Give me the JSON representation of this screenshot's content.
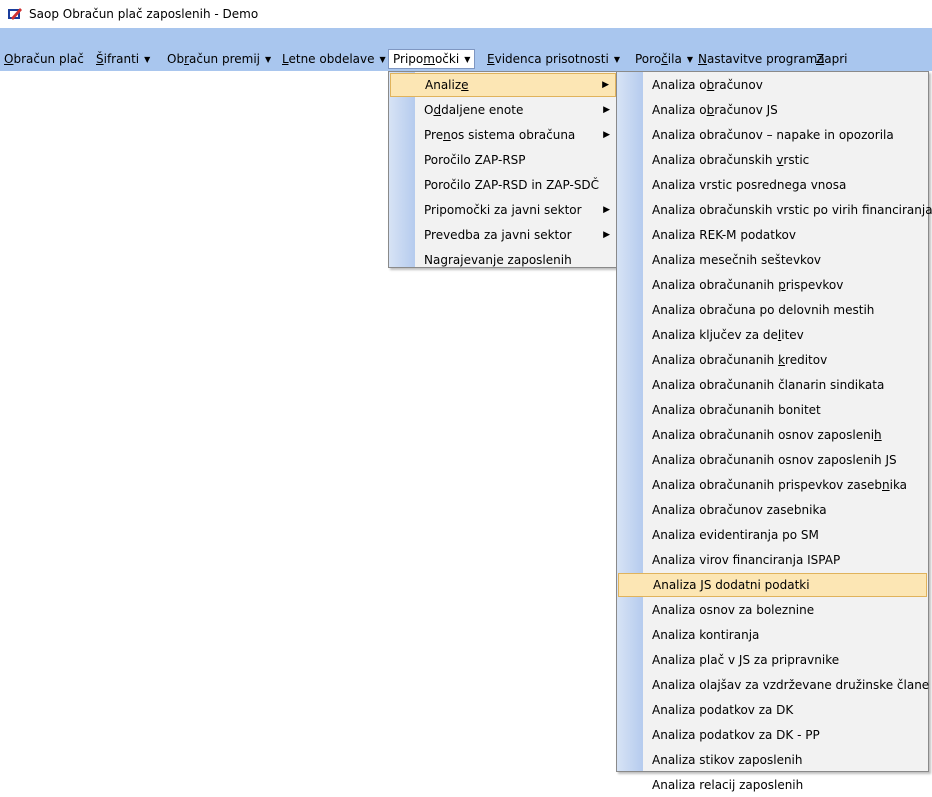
{
  "window": {
    "title": "Saop Obračun plač zaposlenih  - Demo",
    "icon": "app-icon"
  },
  "menubar": {
    "items": [
      {
        "pre": "",
        "key": "O",
        "post": "bračun plač",
        "arrow": false
      },
      {
        "pre": "",
        "key": "Š",
        "post": "ifranti",
        "arrow": true
      },
      {
        "pre": "Ob",
        "key": "r",
        "post": "ačun premij",
        "arrow": true
      },
      {
        "pre": "",
        "key": "L",
        "post": "etne obdelave",
        "arrow": true
      },
      {
        "pre": "Pripo",
        "key": "m",
        "post": "očki",
        "arrow": true
      },
      {
        "pre": "",
        "key": "E",
        "post": "videnca prisotnosti",
        "arrow": true
      },
      {
        "pre": "Poro",
        "key": "č",
        "post": "ila",
        "arrow": true
      },
      {
        "pre": "",
        "key": "N",
        "post": "astavitve programa",
        "arrow": false
      },
      {
        "pre": "",
        "key": "Z",
        "post": "apri",
        "arrow": false
      }
    ]
  },
  "submenu": {
    "items": [
      {
        "pre": "Analiz",
        "key": "e",
        "post": "",
        "arrow": true
      },
      {
        "pre": "O",
        "key": "d",
        "post": "daljene enote",
        "arrow": true
      },
      {
        "pre": "Pre",
        "key": "n",
        "post": "os sistema obračuna",
        "arrow": true
      },
      {
        "pre": "Poročilo ZAP-RSP",
        "key": "",
        "post": "",
        "arrow": false
      },
      {
        "pre": "Poročilo ZAP-RSD  in ZAP-SDČ",
        "key": "",
        "post": "",
        "arrow": false
      },
      {
        "pre": "Pripomočki za javni sektor",
        "key": "",
        "post": "",
        "arrow": true
      },
      {
        "pre": "Prevedba za javni sektor",
        "key": "",
        "post": "",
        "arrow": true
      },
      {
        "pre": "Nagrajevanje zaposlenih",
        "key": "",
        "post": "",
        "arrow": false
      }
    ]
  },
  "analize": {
    "items": [
      {
        "pre": "Analiza o",
        "key": "b",
        "post": "računov"
      },
      {
        "pre": "Analiza o",
        "key": "b",
        "post": "računov JS"
      },
      {
        "pre": "Analiza obračunov – napake in opozorila",
        "key": "",
        "post": ""
      },
      {
        "pre": "Analiza obračunskih ",
        "key": "v",
        "post": "rstic"
      },
      {
        "pre": "Analiza vrstic posrednega vnosa",
        "key": "",
        "post": ""
      },
      {
        "pre": "Analiza obračunskih vrstic po virih financiranja",
        "key": "",
        "post": ""
      },
      {
        "pre": "Analiza REK-M podatkov",
        "key": "",
        "post": ""
      },
      {
        "pre": "Analiza mesečnih seštevkov",
        "key": "",
        "post": ""
      },
      {
        "pre": "Analiza obračunanih ",
        "key": "p",
        "post": "rispevkov"
      },
      {
        "pre": "Analiza obračuna po delovnih mestih",
        "key": "",
        "post": ""
      },
      {
        "pre": "Analiza ključev za de",
        "key": "l",
        "post": "itev"
      },
      {
        "pre": "Analiza obračunanih ",
        "key": "k",
        "post": "reditov"
      },
      {
        "pre": "Analiza obračunanih članarin sindikata",
        "key": "",
        "post": ""
      },
      {
        "pre": "Analiza obračunanih bonitet",
        "key": "",
        "post": ""
      },
      {
        "pre": "Analiza obračunanih osnov zaposleni",
        "key": "h",
        "post": ""
      },
      {
        "pre": "Analiza obračunanih osnov zaposlenih JS",
        "key": "",
        "post": ""
      },
      {
        "pre": "Analiza obračunanih prispevkov zaseb",
        "key": "n",
        "post": "ika"
      },
      {
        "pre": "Analiza obračunov zasebnika",
        "key": "",
        "post": ""
      },
      {
        "pre": "Analiza evidentiranja po SM",
        "key": "",
        "post": ""
      },
      {
        "pre": "Analiza virov financiranja ISPAP",
        "key": "",
        "post": ""
      },
      {
        "pre": "Analiza JS dodatni podatki",
        "key": "",
        "post": ""
      },
      {
        "pre": "Analiza osnov za boleznine",
        "key": "",
        "post": ""
      },
      {
        "pre": "Analiza kontiranja",
        "key": "",
        "post": ""
      },
      {
        "pre": "Analiza plač v JS za pripravnike",
        "key": "",
        "post": ""
      },
      {
        "pre": "Analiza olajšav za vzdrževane družinske člane",
        "key": "",
        "post": ""
      },
      {
        "pre": "Analiza podatkov za DK",
        "key": "",
        "post": ""
      },
      {
        "pre": "Analiza podatkov za DK - PP",
        "key": "",
        "post": ""
      },
      {
        "pre": "Analiza stikov zaposlenih",
        "key": "",
        "post": ""
      },
      {
        "pre": "Analiza relacij zaposlenih",
        "key": "",
        "post": ""
      }
    ]
  },
  "colors": {
    "menubar": "#a9c6ee",
    "highlight": "#fce6b4",
    "highlight_border": "#e0b35c",
    "menu_bg": "#f2f2f2"
  }
}
